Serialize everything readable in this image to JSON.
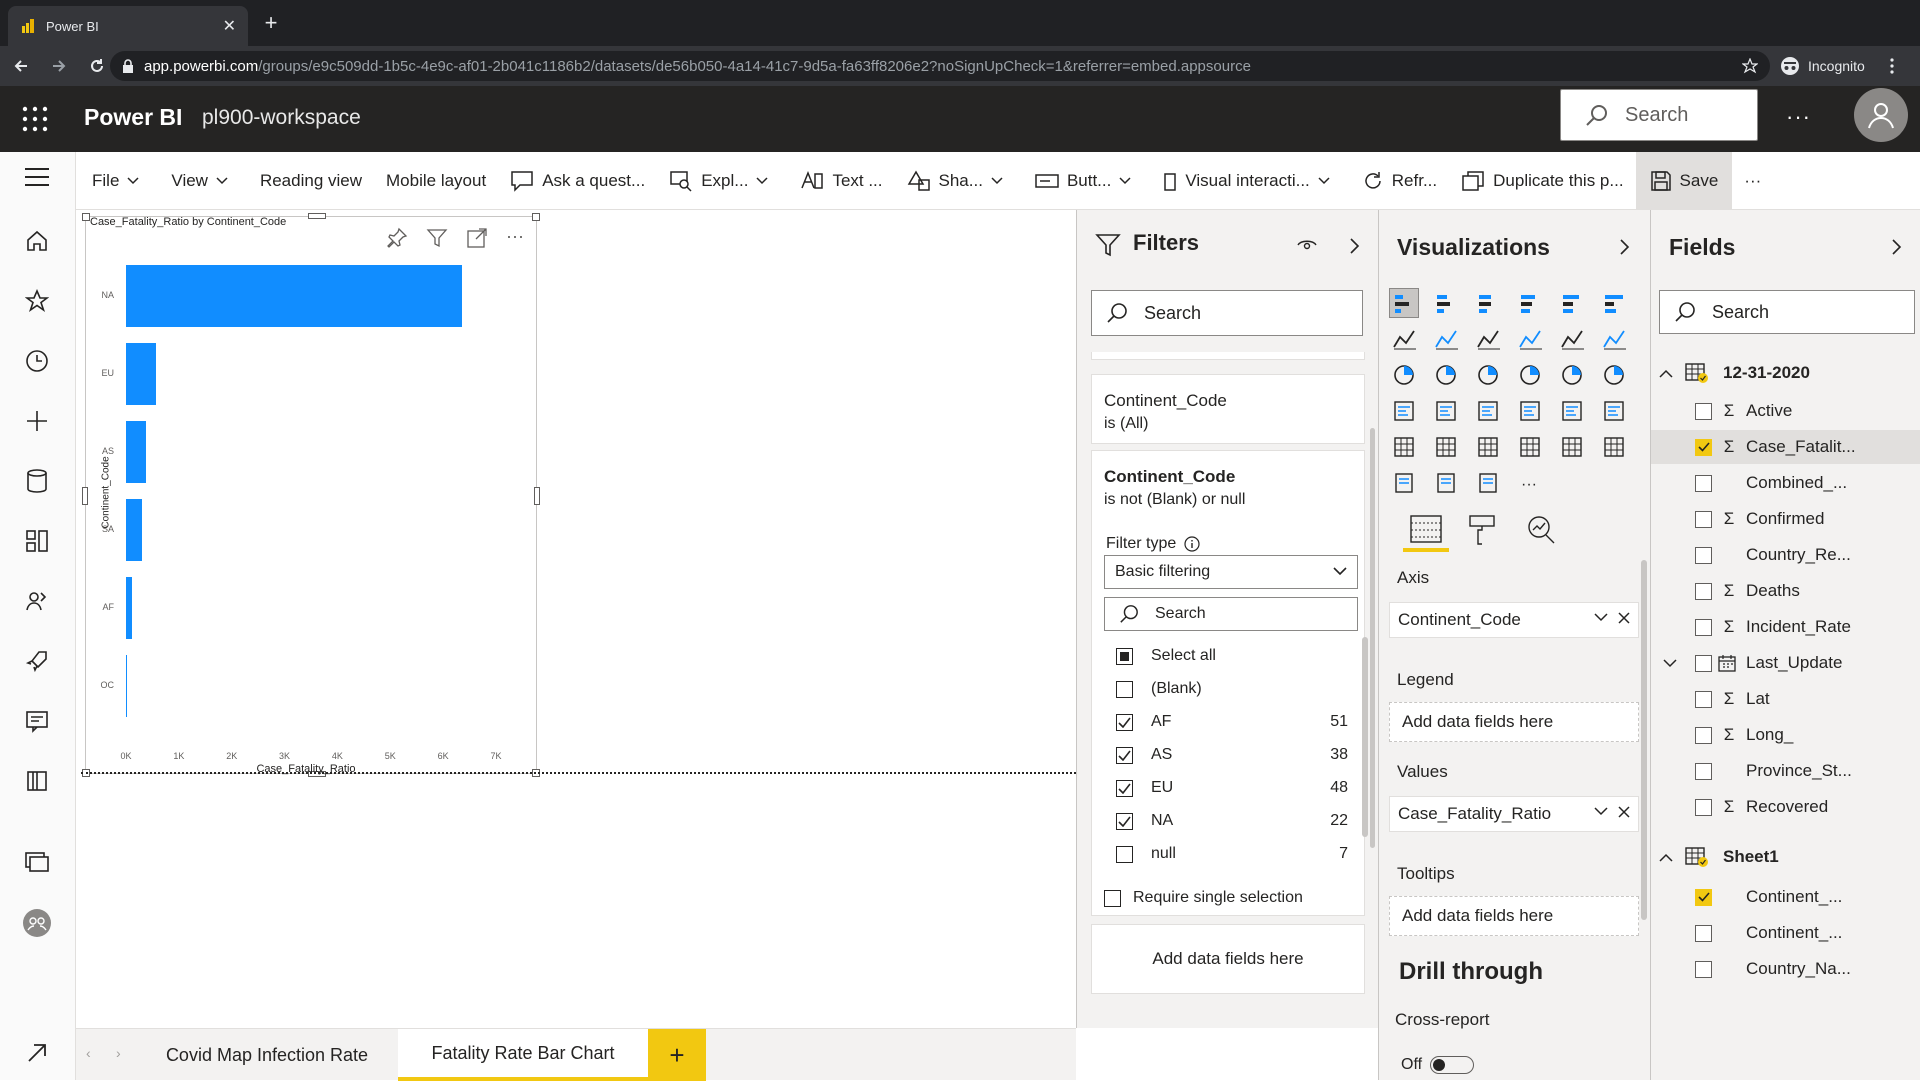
{
  "browser": {
    "tab_title": "Power BI",
    "url_host": "app.powerbi.com",
    "url_path": "/groups/e9c509dd-1b5c-4e9c-af01-2b041c1186b2/datasets/de56b050-4a14-41c7-9d5a-fa63ff8206e2?noSignUpCheck=1&referrer=embed.appsource",
    "incognito_label": "Incognito"
  },
  "header": {
    "app_name": "Power BI",
    "workspace": "pl900-workspace",
    "search_placeholder": "Search",
    "more": "···"
  },
  "ribbon": {
    "file": "File",
    "view": "View",
    "reading_view": "Reading view",
    "mobile_layout": "Mobile layout",
    "ask": "Ask a quest...",
    "explore": "Expl...",
    "text": "Text ...",
    "shapes": "Sha...",
    "buttons": "Butt...",
    "visual_interactions": "Visual interacti...",
    "refresh": "Refr...",
    "duplicate": "Duplicate this p...",
    "save": "Save",
    "more": "···"
  },
  "visual": {
    "title": "Case_Fatality_Ratio by Continent_Code",
    "more": "···"
  },
  "chart_data": {
    "type": "bar",
    "orientation": "horizontal",
    "categories": [
      "NA",
      "EU",
      "AS",
      "SA",
      "AF",
      "OC"
    ],
    "values": [
      6350,
      560,
      370,
      300,
      110,
      20
    ],
    "xlabel": "Case_Fatality_Ratio",
    "ylabel": "Continent_Code",
    "xlim": [
      0,
      7000
    ],
    "xticks": [
      "0K",
      "1K",
      "2K",
      "3K",
      "4K",
      "5K",
      "6K",
      "7K"
    ],
    "color": "#118dff",
    "grid": false
  },
  "filters": {
    "title": "Filters",
    "search_placeholder": "Search",
    "card1_field": "Continent_Code",
    "card1_state": "is (All)",
    "card2_field": "Continent_Code",
    "card2_state": "is not (Blank) or null",
    "filter_type_label": "Filter type",
    "filter_type_value": "Basic filtering",
    "inner_search_placeholder": "Search",
    "items": [
      {
        "label": "Select all",
        "count": "",
        "state": "partial"
      },
      {
        "label": "(Blank)",
        "count": "",
        "state": "off"
      },
      {
        "label": "AF",
        "count": "51",
        "state": "on"
      },
      {
        "label": "AS",
        "count": "38",
        "state": "on"
      },
      {
        "label": "EU",
        "count": "48",
        "state": "on"
      },
      {
        "label": "NA",
        "count": "22",
        "state": "on"
      },
      {
        "label": "null",
        "count": "7",
        "state": "off"
      }
    ],
    "require_single": "Require single selection",
    "add_fields": "Add data fields here"
  },
  "visualizations": {
    "title": "Visualizations",
    "axis_label": "Axis",
    "axis_field": "Continent_Code",
    "legend_label": "Legend",
    "legend_add": "Add data fields here",
    "values_label": "Values",
    "values_field": "Case_Fatality_Ratio",
    "tooltips_label": "Tooltips",
    "tooltips_add": "Add data fields here",
    "drill_through": "Drill through",
    "cross_report": "Cross-report",
    "toggle_state": "Off",
    "more": "···"
  },
  "fields": {
    "title": "Fields",
    "search_placeholder": "Search",
    "table1": "12-31-2020",
    "table1_fields": [
      {
        "name": "Active",
        "sigma": true,
        "checked": false
      },
      {
        "name": "Case_Fatalit...",
        "sigma": true,
        "checked": true
      },
      {
        "name": "Combined_...",
        "sigma": false,
        "checked": false
      },
      {
        "name": "Confirmed",
        "sigma": true,
        "checked": false
      },
      {
        "name": "Country_Re...",
        "sigma": false,
        "checked": false
      },
      {
        "name": "Deaths",
        "sigma": true,
        "checked": false
      },
      {
        "name": "Incident_Rate",
        "sigma": true,
        "checked": false
      },
      {
        "name": "Last_Update",
        "sigma": false,
        "checked": false
      },
      {
        "name": "Lat",
        "sigma": true,
        "checked": false
      },
      {
        "name": "Long_",
        "sigma": true,
        "checked": false
      },
      {
        "name": "Province_St...",
        "sigma": false,
        "checked": false
      },
      {
        "name": "Recovered",
        "sigma": true,
        "checked": false
      }
    ],
    "table2": "Sheet1",
    "table2_fields": [
      {
        "name": "Continent_...",
        "checked": true
      },
      {
        "name": "Continent_...",
        "checked": false
      },
      {
        "name": "Country_Na...",
        "checked": false
      }
    ]
  },
  "pages": {
    "tab1": "Covid Map Infection Rate",
    "tab2": "Fatality Rate Bar Chart",
    "add": "+"
  }
}
